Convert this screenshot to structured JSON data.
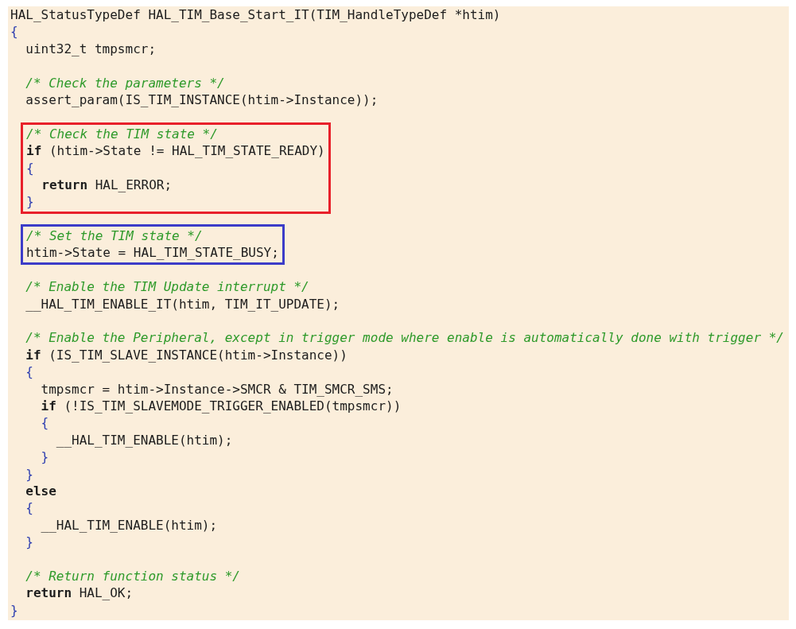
{
  "code_view": {
    "blocks": [
      {
        "kind": "plain",
        "lines": [
          {
            "kind": "code",
            "text": "HAL_StatusTypeDef HAL_TIM_Base_Start_IT(TIM_HandleTypeDef *htim)"
          },
          {
            "kind": "brace",
            "text": "{"
          },
          {
            "kind": "code",
            "text": "  uint32_t tmpsmcr;"
          },
          {
            "kind": "blank"
          },
          {
            "kind": "comment",
            "text": "  /* Check the parameters */"
          },
          {
            "kind": "code",
            "text": "  assert_param(IS_TIM_INSTANCE(htim->Instance));"
          },
          {
            "kind": "blank"
          }
        ]
      },
      {
        "kind": "highlight",
        "color": "#e8202a",
        "lines": [
          {
            "kind": "comment",
            "text": "/* Check the TIM state */"
          },
          {
            "kind": "code",
            "text": "**if** (htim->State != HAL_TIM_STATE_READY)"
          },
          {
            "kind": "brace",
            "text": "{"
          },
          {
            "kind": "code",
            "text": "  **return** HAL_ERROR;"
          },
          {
            "kind": "brace",
            "text": "}"
          }
        ]
      },
      {
        "kind": "plain",
        "lines": [
          {
            "kind": "blank"
          }
        ]
      },
      {
        "kind": "highlight",
        "color": "#3c3cc8",
        "lines": [
          {
            "kind": "comment",
            "text": "/* Set the TIM state */"
          },
          {
            "kind": "code",
            "text": "htim->State = HAL_TIM_STATE_BUSY;"
          }
        ]
      },
      {
        "kind": "plain",
        "lines": [
          {
            "kind": "blank"
          },
          {
            "kind": "comment",
            "text": "  /* Enable the TIM Update interrupt */"
          },
          {
            "kind": "code",
            "text": "  __HAL_TIM_ENABLE_IT(htim, TIM_IT_UPDATE);"
          },
          {
            "kind": "blank"
          },
          {
            "kind": "comment",
            "text": "  /* Enable the Peripheral, except in trigger mode where enable is automatically done with trigger */"
          },
          {
            "kind": "code",
            "text": "  **if** (IS_TIM_SLAVE_INSTANCE(htim->Instance))"
          },
          {
            "kind": "brace",
            "text": "  {"
          },
          {
            "kind": "code",
            "text": "    tmpsmcr = htim->Instance->SMCR & TIM_SMCR_SMS;"
          },
          {
            "kind": "code",
            "text": "    **if** (!IS_TIM_SLAVEMODE_TRIGGER_ENABLED(tmpsmcr))"
          },
          {
            "kind": "brace",
            "text": "    {"
          },
          {
            "kind": "code",
            "text": "      __HAL_TIM_ENABLE(htim);"
          },
          {
            "kind": "brace",
            "text": "    }"
          },
          {
            "kind": "brace",
            "text": "  }"
          },
          {
            "kind": "keyword",
            "text": "  else"
          },
          {
            "kind": "brace",
            "text": "  {"
          },
          {
            "kind": "code",
            "text": "    __HAL_TIM_ENABLE(htim);"
          },
          {
            "kind": "brace",
            "text": "  }"
          },
          {
            "kind": "blank"
          },
          {
            "kind": "comment",
            "text": "  /* Return function status */"
          },
          {
            "kind": "code",
            "text": "  **return** HAL_OK;"
          },
          {
            "kind": "brace",
            "text": "}"
          }
        ]
      }
    ]
  }
}
